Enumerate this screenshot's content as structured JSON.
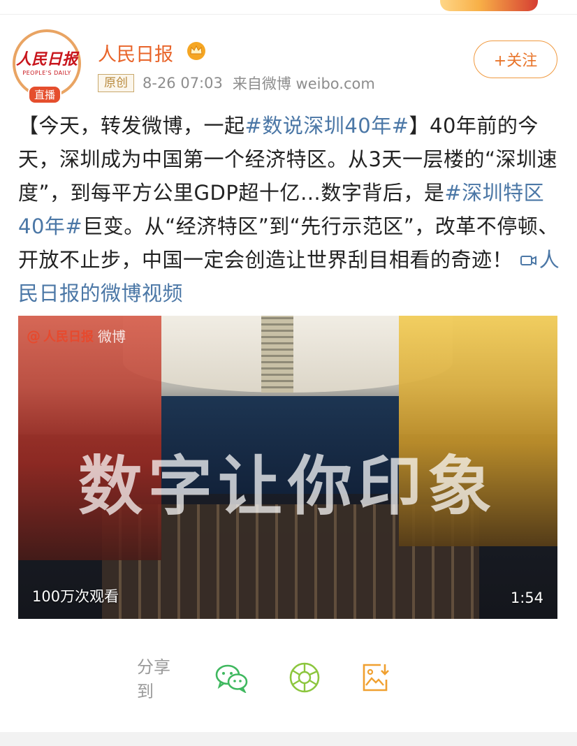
{
  "account": {
    "name": "人民日报",
    "avatar_logo_text": "人民日报",
    "avatar_logo_subtext": "PEOPLE'S DAILY",
    "live_badge": "直播",
    "original_tag": "原创",
    "timestamp": "8-26 07:03",
    "source": "来自微博 weibo.com",
    "follow_label": "+关注"
  },
  "post": {
    "segments": [
      {
        "type": "text",
        "text": "【今天，转发微博，一起"
      },
      {
        "type": "tag",
        "text": "#数说深圳40年#"
      },
      {
        "type": "text",
        "text": "】40年前的今天，深圳成为中国第一个经济特区。从3天一层楼的“深圳速度”，到每平方公里GDP超十亿…数字背后，是"
      },
      {
        "type": "tag",
        "text": "#深圳特区40年#"
      },
      {
        "type": "text",
        "text": "巨变。从“经济特区”到“先行示范区”，改革不停顿、开放不止步，中国一定会创造让世界刮目相看的奇迹！ "
      },
      {
        "type": "link",
        "text": "人民日报的微博视频"
      }
    ]
  },
  "video": {
    "watermark_brand": "人民日报",
    "watermark_suffix": "微博",
    "overlay_caption": "数字让你印象",
    "views": "100万次观看",
    "duration": "1:54"
  },
  "share": {
    "label": "分享到",
    "targets": [
      {
        "name": "wechat",
        "icon": "wechat-icon",
        "color": "#3fb85f"
      },
      {
        "name": "moments",
        "icon": "wechat-moments-icon",
        "color": "#8cc63e"
      },
      {
        "name": "save-image",
        "icon": "save-image-icon",
        "color": "#f0a030"
      }
    ]
  },
  "colors": {
    "accent_orange": "#e8642a",
    "tag_blue": "#4b77a6",
    "meta_gray": "#8d8d8d"
  }
}
